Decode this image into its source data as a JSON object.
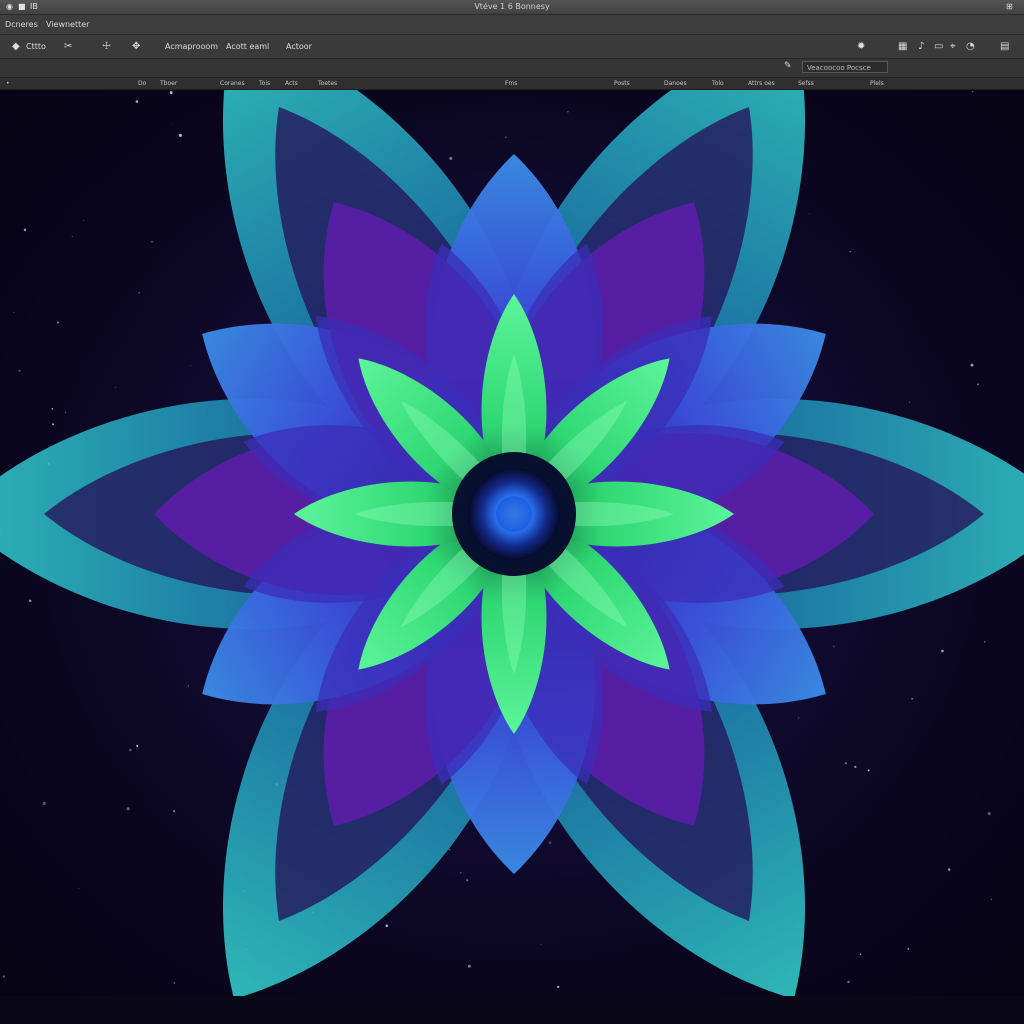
{
  "window": {
    "title": "Vtéve 1 6 Bonnesy",
    "controls_left": [
      "◉",
      "■",
      "IB"
    ],
    "controls_right": "⊞"
  },
  "menubar": {
    "items": [
      "Dcneres",
      "Viewnetter"
    ]
  },
  "toolbar": {
    "tool1_label": "Cttto",
    "tool2_icon": "✂",
    "tool3_icon": "☩",
    "tool4_icon": "✥",
    "btn_a": "Acmaprooom",
    "btn_b": "Acott eaml",
    "btn_c": "Actoor",
    "right_icons": [
      "✹",
      "▦",
      "♪",
      "▭",
      "⌖",
      "◔",
      "▤"
    ]
  },
  "optbar": {
    "search_value": "Veacoocoo Pocsce"
  },
  "ruler": {
    "columns": [
      "Do",
      "Tboer",
      "Coranes",
      "Tois",
      "Acts",
      "Toetes",
      "Fms",
      "Posts",
      "Danoes",
      "Tolo",
      "Attrs oes",
      "Sefss",
      "Plels"
    ]
  },
  "colors": {
    "canvas_bg": "#0c0724",
    "petal_green": "#3cf07a",
    "petal_blue": "#3a4bd8",
    "petal_violet": "#5a1fa6",
    "frost_cyan": "#27c7c9"
  }
}
